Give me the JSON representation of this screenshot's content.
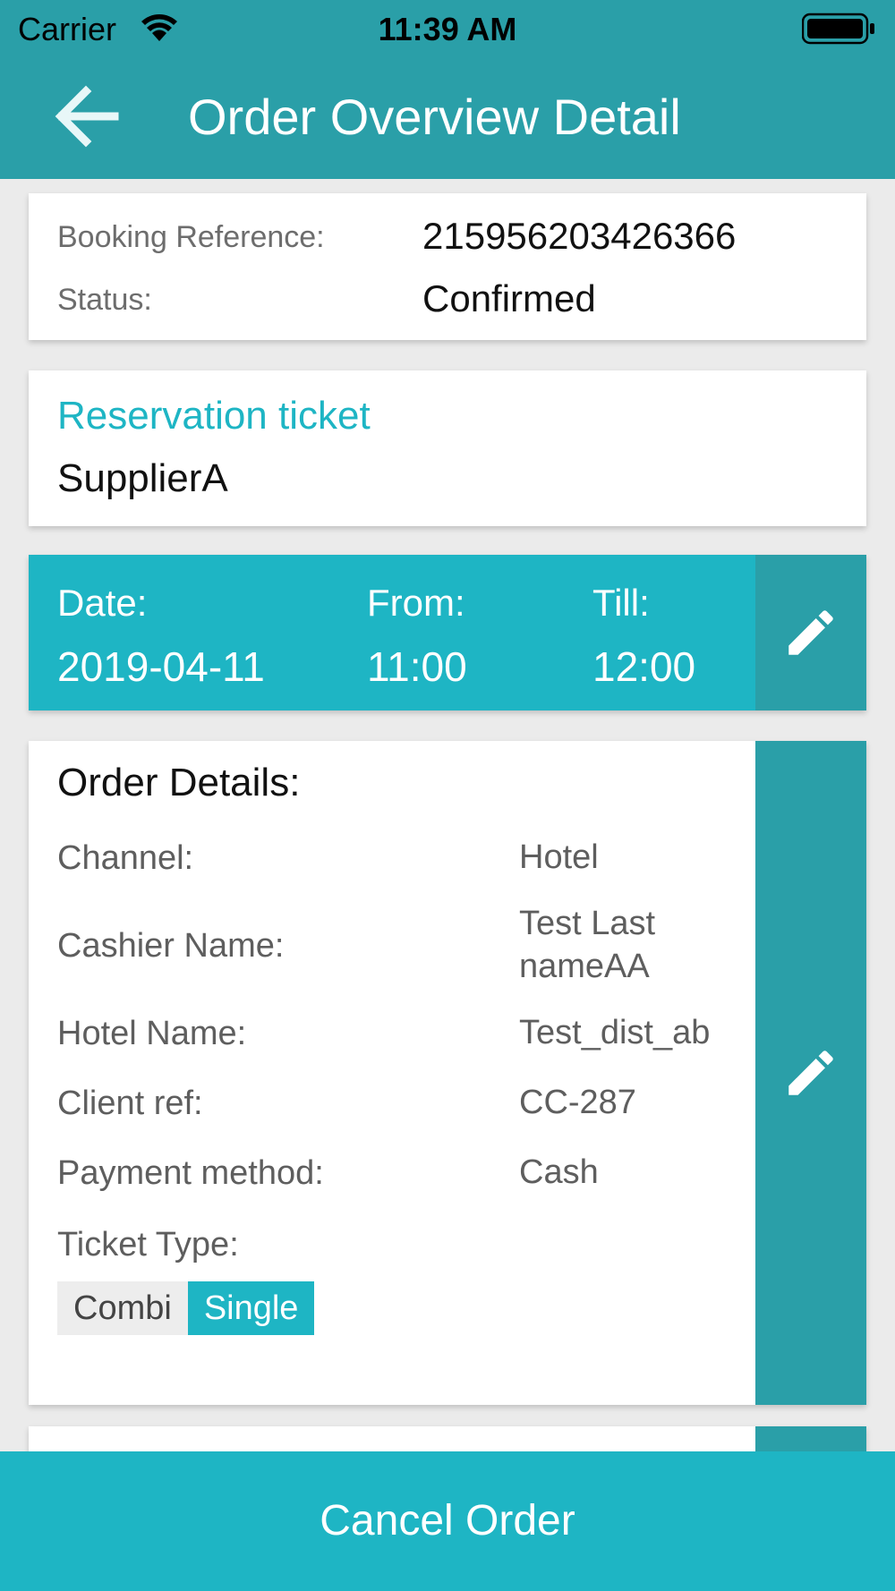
{
  "status_bar": {
    "carrier": "Carrier",
    "time": "11:39 AM"
  },
  "header": {
    "title": "Order Overview Detail",
    "back_icon": "arrow-left-icon"
  },
  "booking": {
    "reference_label": "Booking Reference:",
    "reference_value": "215956203426366",
    "status_label": "Status:",
    "status_value": "Confirmed"
  },
  "reservation": {
    "title": "Reservation ticket",
    "supplier": "SupplierA"
  },
  "schedule": {
    "date_label": "Date:",
    "date_value": "2019-04-11",
    "from_label": "From:",
    "from_value": "11:00",
    "till_label": "Till:",
    "till_value": "12:00",
    "edit_icon": "pencil-icon"
  },
  "order_details": {
    "title": "Order Details:",
    "rows": [
      {
        "label": "Channel:",
        "value": "Hotel"
      },
      {
        "label": "Cashier Name:",
        "value": "Test Last nameAA"
      },
      {
        "label": "Hotel Name:",
        "value": "Test_dist_ab"
      },
      {
        "label": "Client ref:",
        "value": "CC-287"
      },
      {
        "label": "Payment method:",
        "value": "Cash"
      }
    ],
    "ticket_type_label": "Ticket Type:",
    "ticket_type_options": [
      "Combi",
      "Single"
    ],
    "ticket_type_selected": "Single",
    "edit_icon": "pencil-icon"
  },
  "footer": {
    "cancel_label": "Cancel Order"
  },
  "colors": {
    "header_bg": "#2a9fa8",
    "accent": "#1eb5c4",
    "page_bg": "#ebebeb"
  }
}
